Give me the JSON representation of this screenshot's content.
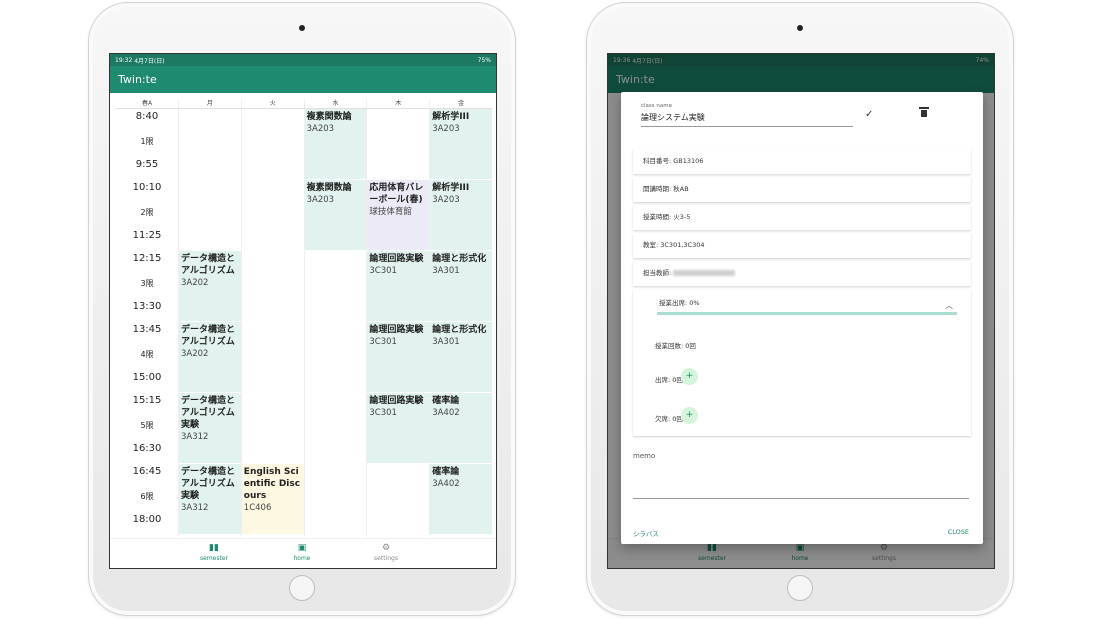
{
  "left": {
    "status": {
      "time": "19:32",
      "date": "4月7日(日)",
      "battery": "75%"
    },
    "app_title": "Twin:te",
    "header": [
      "春A",
      "月",
      "火",
      "水",
      "木",
      "金"
    ],
    "periods": [
      {
        "start": "8:40",
        "label": "1限",
        "end": "9:55"
      },
      {
        "start": "10:10",
        "label": "2限",
        "end": "11:25"
      },
      {
        "start": "12:15",
        "label": "3限",
        "end": "13:30"
      },
      {
        "start": "13:45",
        "label": "4限",
        "end": "15:00"
      },
      {
        "start": "15:15",
        "label": "5限",
        "end": "16:30"
      },
      {
        "start": "16:45",
        "label": "6限",
        "end": "18:00"
      }
    ],
    "days": [
      [
        {},
        {},
        {
          "name": "データ構造とアルゴリズム",
          "room": "3A202",
          "color": "green"
        },
        {
          "name": "データ構造とアルゴリズム",
          "room": "3A202",
          "color": "green"
        },
        {
          "name": "データ構造とアルゴリズム実験",
          "room": "3A312",
          "color": "green"
        },
        {
          "name": "データ構造とアルゴリズム実験",
          "room": "3A312",
          "color": "green"
        }
      ],
      [
        {},
        {},
        {},
        {},
        {},
        {
          "name": "English Scientific Discours",
          "room": "1C406",
          "color": "yellow"
        }
      ],
      [
        {
          "name": "複素関数論",
          "room": "3A203",
          "color": "green"
        },
        {
          "name": "複素関数論",
          "room": "3A203",
          "color": "green"
        },
        {},
        {},
        {},
        {}
      ],
      [
        {},
        {
          "name": "応用体育バレーボール(春)",
          "room": "球技体育館",
          "color": "purple"
        },
        {
          "name": "論理回路実験",
          "room": "3C301",
          "color": "green"
        },
        {
          "name": "論理回路実験",
          "room": "3C301",
          "color": "green"
        },
        {
          "name": "論理回路実験",
          "room": "3C301",
          "color": "green"
        },
        {}
      ],
      [
        {
          "name": "解析学III",
          "room": "3A203",
          "color": "green"
        },
        {
          "name": "解析学III",
          "room": "3A203",
          "color": "green"
        },
        {
          "name": "論理と形式化",
          "room": "3A301",
          "color": "green"
        },
        {
          "name": "論理と形式化",
          "room": "3A301",
          "color": "green"
        },
        {
          "name": "確率論",
          "room": "3A402",
          "color": "green"
        },
        {
          "name": "確率論",
          "room": "3A402",
          "color": "green"
        }
      ]
    ],
    "nav": {
      "semester": "semester",
      "home": "home",
      "settings": "settings"
    }
  },
  "right": {
    "status": {
      "time": "19:36",
      "date": "4月7日(日)",
      "battery": "74%"
    },
    "app_title": "Twin:te",
    "class_name_label": "class name",
    "class_name": "論理システム実験",
    "course_code": "科目番号: GB13106",
    "term": "開講時期: 秋AB",
    "period": "授業時間: 火3-5",
    "room": "教室: 3C301,3C304",
    "instructor_label": "担当教師:",
    "attendance_rate": "授業出席: 0%",
    "attendance_progress": 0,
    "class_count": "授業回数: 0回",
    "present": "出席: 0回",
    "absent": "欠席: 0回",
    "plus_symbol": "+",
    "memo_label": "memo",
    "syllabus": "シラバス",
    "close": "CLOSE",
    "nav": {
      "semester": "semester",
      "home": "home",
      "settings": "settings"
    }
  },
  "colors": {
    "primary": "#1e8a70",
    "cell_green": "#e2f3ef",
    "cell_purple": "#eceaf6",
    "cell_yellow": "#fdf8e2"
  }
}
